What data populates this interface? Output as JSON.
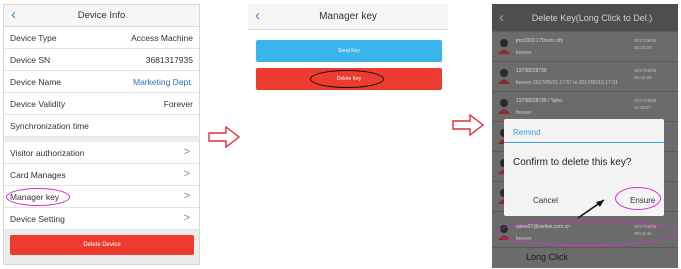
{
  "panel1": {
    "title": "Device Info",
    "back_icon": "‹",
    "rows": [
      {
        "label": "Device Type",
        "value": "Access Machine"
      },
      {
        "label": "Device SN",
        "value": "3681317935"
      },
      {
        "label": "Device Name",
        "value": "Marketing Dept."
      },
      {
        "label": "Device Validity",
        "value": "Forever"
      },
      {
        "label": "Synchronization time",
        "value": ""
      },
      {
        "label": "Visitor authorization",
        "value": ">"
      },
      {
        "label": "Card Manages",
        "value": ">"
      },
      {
        "label": "Manager key",
        "value": ">"
      },
      {
        "label": "Device Setting",
        "value": ">"
      }
    ],
    "delete_button": "Delete Device",
    "highlight_color": "#d030d0"
  },
  "panel2": {
    "title": "Manager key",
    "back_icon": "‹",
    "send_button": "Send Key",
    "delete_button": "Delete Key",
    "send_color": "#3ab5ec",
    "delete_color": "#ee3b2f"
  },
  "panel3": {
    "title": "Delete Key(Long Click to Del.)",
    "back_icon": "‹",
    "keys": [
      {
        "name": "jmz2003 170com cify",
        "sub": "forever",
        "date": "2017/08/09 06:35:29"
      },
      {
        "name": "13798228730",
        "sub": "forever 2017/05/15 17:57 to 2017/05/15 17:01",
        "date": "2017/08/09 06:46:29"
      },
      {
        "name": "13798228730 / Ypho",
        "sub": "forever",
        "date": "2017/08/09 11:28:27"
      },
      {
        "name": "",
        "sub": "",
        "date": ""
      },
      {
        "name": "",
        "sub": "",
        "date": ""
      },
      {
        "name": "",
        "sub": "",
        "date": ""
      },
      {
        "name": "sales07@weltek.com.cn",
        "sub": "forever",
        "date": "2017/08/09 09:18:46"
      }
    ],
    "dialog": {
      "title": "Remind",
      "message": "Confirm to delete this key?",
      "cancel": "Cancel",
      "ensure": "Ensure"
    },
    "long_click_label": "Long Click"
  },
  "arrow_icon": "right-arrow-icon"
}
